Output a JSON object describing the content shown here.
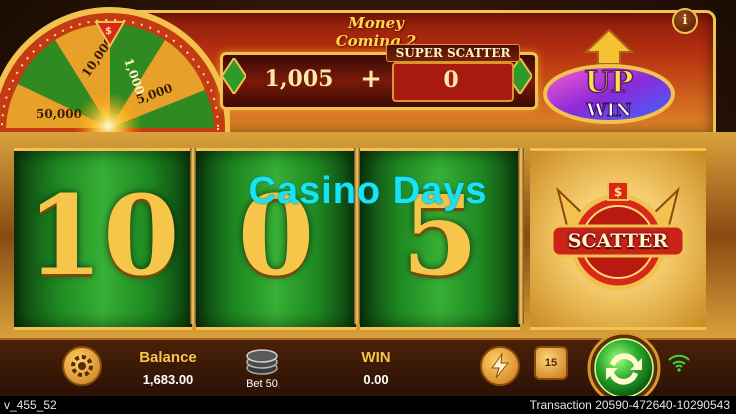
{
  "header": {
    "game_title": "Money Coming 2",
    "info_label": "i"
  },
  "wheel": {
    "segments": [
      "10,000",
      "1,000",
      "50,000",
      "5,000"
    ]
  },
  "counter": {
    "value": "1,005",
    "operator": "+",
    "super_scatter_label": "SUPER SCATTER",
    "super_scatter_value": "0"
  },
  "upwin": {
    "line1": "UP",
    "line2": "WIN"
  },
  "reels": {
    "digits": [
      "10",
      "0",
      "5"
    ],
    "scatter_label": "SCATTER"
  },
  "watermark": "Casino Days",
  "bottom": {
    "balance_label": "Balance",
    "balance_value": "1,683.00",
    "bet_label": "Bet",
    "bet_value": "50",
    "win_label": "WIN",
    "win_value": "0.00",
    "auto_spins": "15"
  },
  "footer": {
    "version": "v_455_52",
    "transaction": "Transaction 20590-472640-10290543"
  },
  "colors": {
    "reel_green": "#1f8a22",
    "gold": "#f2c14e",
    "watermark_cyan": "#16e4f2",
    "frame_red": "#b8320f"
  },
  "icons": [
    "info-icon",
    "gear-icon",
    "coin-stack-icon",
    "lightning-icon",
    "spin-icon",
    "wifi-icon",
    "dollar-icon",
    "arrow-up-icon"
  ]
}
